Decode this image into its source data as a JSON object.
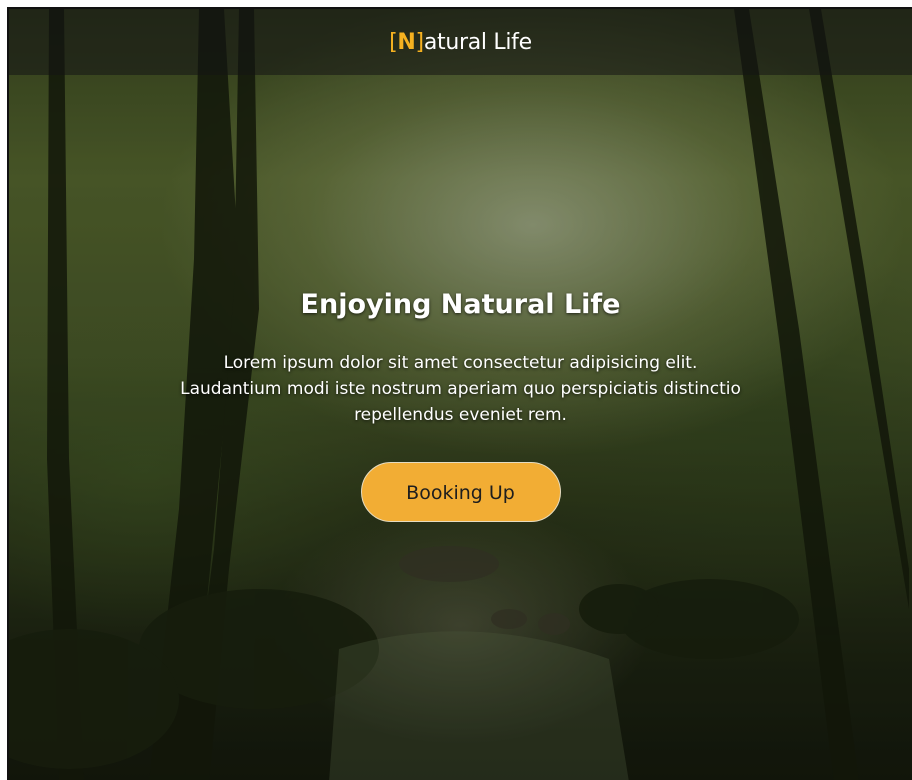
{
  "header": {
    "brand_initial": "N",
    "brand_rest": "atural Life",
    "brand_accent_color": "#f5b120"
  },
  "hero": {
    "title": "Enjoying Natural Life",
    "lines": [
      "Lorem ipsum dolor sit amet consectetur adipisicing elit.",
      "Laudantium modi iste nostrum aperiam quo perspiciatis distinctio",
      "repellendus eveniet rem."
    ],
    "cta_label": "Booking Up",
    "cta_color": "#f2ad34",
    "background": "forest-stream-photo"
  }
}
